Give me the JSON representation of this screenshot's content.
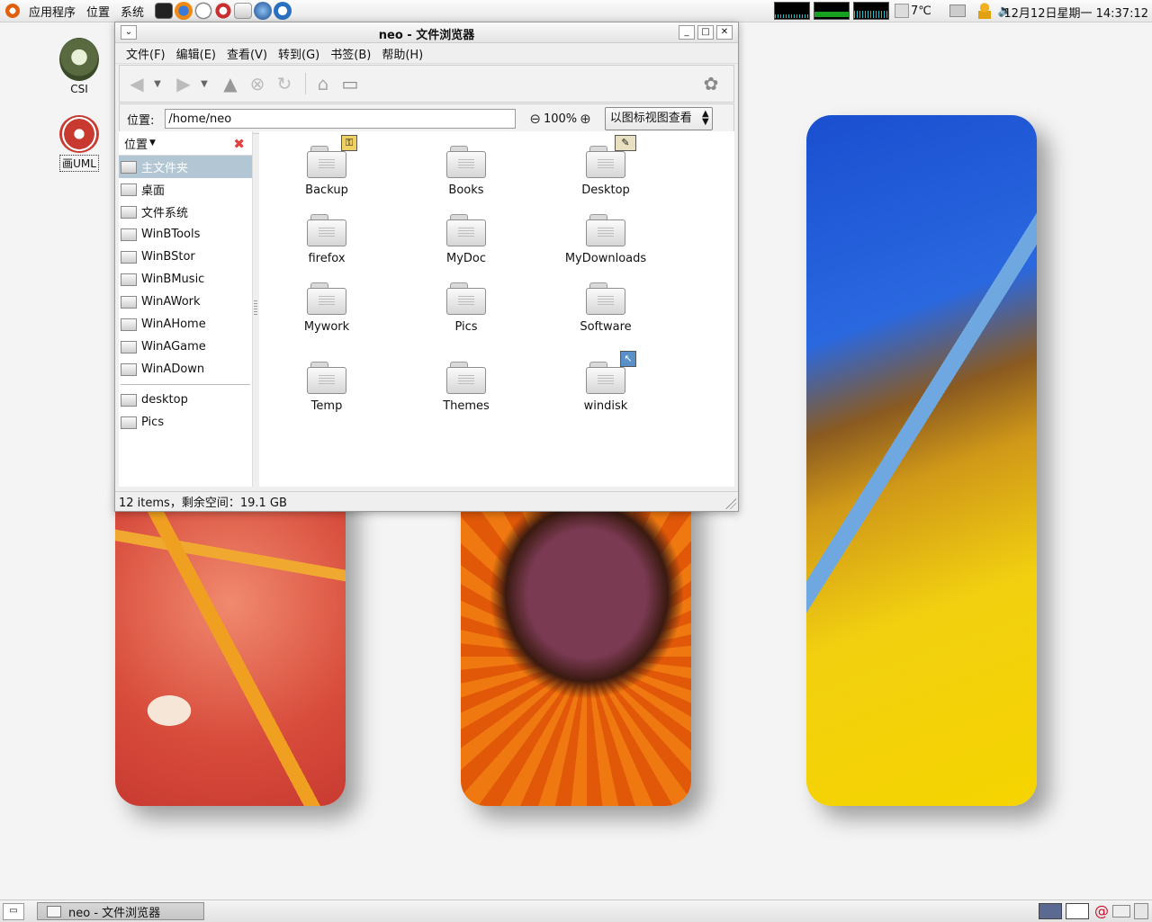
{
  "top_panel": {
    "menus": [
      "应用程序",
      "位置",
      "系统"
    ],
    "weather": "7℃",
    "clock": "12月12日星期一 14:37:12"
  },
  "desktop_icons": [
    {
      "label": "CSI"
    },
    {
      "label": "画UML"
    }
  ],
  "window": {
    "title": "neo - 文件浏览器",
    "menus": [
      "文件(F)",
      "编辑(E)",
      "查看(V)",
      "转到(G)",
      "书签(B)",
      "帮助(H)"
    ],
    "location_label": "位置:",
    "location_value": "/home/neo",
    "zoom_level": "100%",
    "view_mode": "以图标视图查看",
    "sidebar": {
      "header": "位置",
      "places": [
        "主文件夹",
        "桌面",
        "文件系统",
        "WinBTools",
        "WinBStor",
        "WinBMusic",
        "WinAWork",
        "WinAHome",
        "WinAGame",
        "WinADown"
      ],
      "bookmarks": [
        "desktop",
        "Pics"
      ]
    },
    "files": [
      "Backup",
      "Books",
      "Desktop",
      "firefox",
      "MyDoc",
      "MyDownloads",
      "Mywork",
      "Pics",
      "Software",
      "Temp",
      "Themes",
      "windisk"
    ],
    "status": "12 items，剩余空间：19.1 GB"
  },
  "taskbar": {
    "item": "neo - 文件浏览器"
  },
  "colors": {
    "selection": "#b3c6d4",
    "panel": "#ececec"
  }
}
